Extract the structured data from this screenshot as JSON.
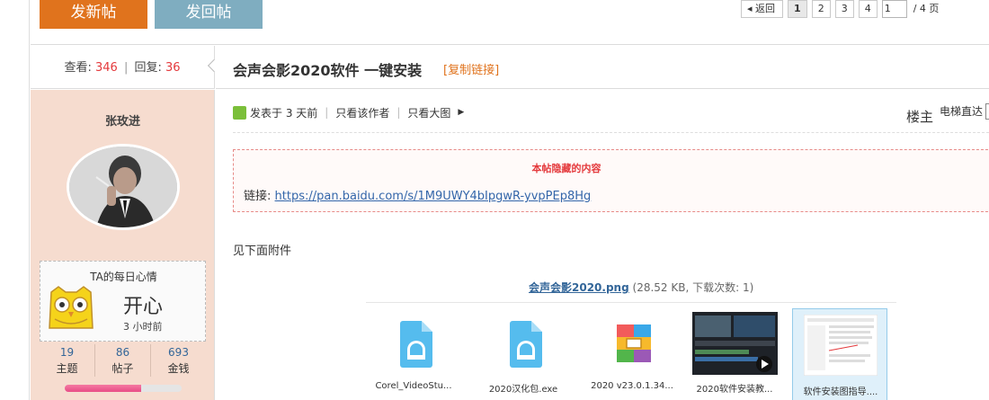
{
  "toolbar": {
    "new_post": "发新帖",
    "reply": "发回帖"
  },
  "pager": {
    "back": "返回",
    "pages": [
      "1",
      "2",
      "3",
      "4"
    ],
    "current": "1",
    "input_value": "1",
    "total": "/ 4 页"
  },
  "stats": {
    "views_label": "查看:",
    "views": "346",
    "sep": "|",
    "replies_label": "回复:",
    "replies": "36"
  },
  "thread": {
    "title": "会声会影2020软件 一键安装",
    "copy_link": "[复制链接]"
  },
  "user": {
    "name": "张玫进",
    "mood": {
      "title": "TA的每日心情",
      "text": "开心",
      "time": "3 小时前"
    },
    "stats": [
      {
        "value": "19",
        "label": "主题"
      },
      {
        "value": "86",
        "label": "帖子"
      },
      {
        "value": "693",
        "label": "金钱"
      }
    ],
    "progress": 0.65
  },
  "post": {
    "posted": "发表于 3 天前",
    "only_author": "只看该作者",
    "large_image": "只看大图",
    "floor": "楼主",
    "elevator": "电梯直达",
    "hidden_title": "本帖隐藏的内容",
    "link_label": "链接:",
    "link_url": "https://pan.baidu.com/s/1M9UWY4bIpgwR-yvpPEp8Hg",
    "attach_note": "见下面附件",
    "attachment": {
      "name": "会声会影2020.png",
      "info": "(28.52 KB, 下载次数: 1)"
    }
  },
  "thumbnails": [
    {
      "label": "Corel_VideoStu...",
      "icon": "installer-file-icon"
    },
    {
      "label": "2020汉化包.exe",
      "icon": "installer-file-icon"
    },
    {
      "label": "2020 v23.0.1.34...",
      "icon": "archive-icon"
    },
    {
      "label": "2020软件安装教...",
      "icon": "video-thumbnail"
    },
    {
      "label": "软件安装图指导....",
      "icon": "image-thumbnail"
    }
  ],
  "colors": {
    "accent_orange": "#e0731d",
    "reply_blue": "#7fadc0",
    "red": "#e4393c",
    "panel_bg": "#f6dccf"
  }
}
